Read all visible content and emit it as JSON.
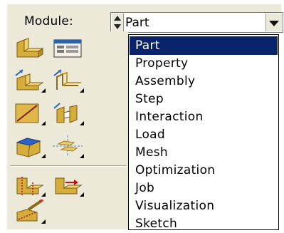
{
  "module_bar": {
    "label": "Module:",
    "selected": "Part"
  },
  "dropdown": {
    "options": [
      "Part",
      "Property",
      "Assembly",
      "Step",
      "Interaction",
      "Load",
      "Mesh",
      "Optimization",
      "Job",
      "Visualization",
      "Sketch"
    ],
    "selected_index": 0
  },
  "toolbox": {
    "tools": [
      "create-part-icon",
      "part-manager-icon",
      "create-solid-extrude-icon",
      "create-shell-extrude-icon",
      "create-wire-icon",
      "create-cut-extrude-icon",
      "create-round-fillet-icon",
      "create-datum-plane-icon",
      "partition-face-icon",
      "partition-cell-icon",
      "virtual-topology-icon"
    ]
  },
  "colors": {
    "highlight": "#0a246a",
    "toolbar_bg": "#ece9d8",
    "icon_gold": "#c8a233"
  }
}
